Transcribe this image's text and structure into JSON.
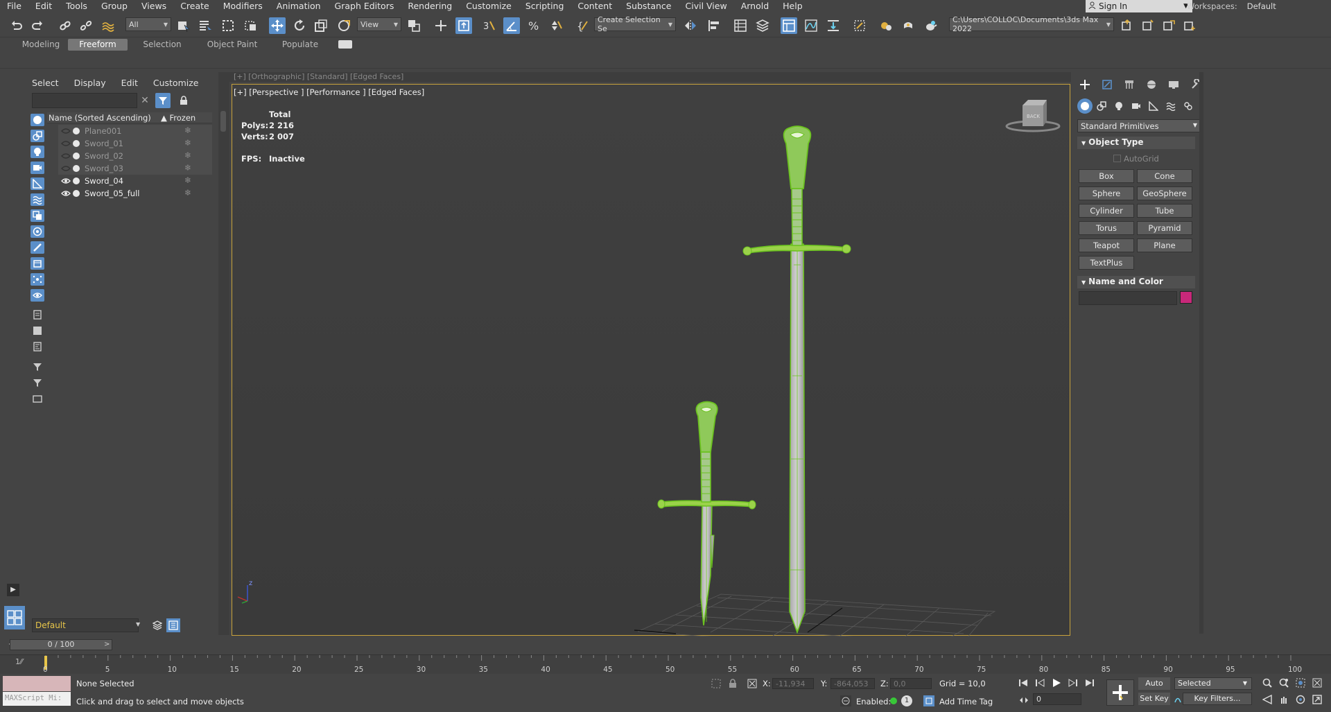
{
  "menu": [
    "File",
    "Edit",
    "Tools",
    "Group",
    "Views",
    "Create",
    "Modifiers",
    "Animation",
    "Graph Editors",
    "Rendering",
    "Customize",
    "Scripting",
    "Content",
    "Substance",
    "Civil View",
    "Arnold",
    "Help"
  ],
  "account": {
    "signin": "Sign In",
    "workspace_label": "Workspaces:",
    "workspace_value": "Default"
  },
  "toolbar": {
    "filter": "All",
    "refcoord": "View",
    "selset": "Create Selection Se",
    "project_path": "C:\\Users\\COLLOC\\Documents\\3ds Max 2022"
  },
  "ribbon_tabs": [
    "Modeling",
    "Freeform",
    "Selection",
    "Object Paint",
    "Populate"
  ],
  "explorer": {
    "menu": [
      "Select",
      "Display",
      "Edit",
      "Customize"
    ],
    "col_name": "Name (Sorted Ascending)",
    "col_frozen": "▲ Frozen",
    "rows": [
      {
        "name": "Plane001",
        "visible": false
      },
      {
        "name": "Sword_01",
        "visible": false
      },
      {
        "name": "Sword_02",
        "visible": false
      },
      {
        "name": "Sword_03",
        "visible": false
      },
      {
        "name": "Sword_04",
        "visible": true
      },
      {
        "name": "Sword_05_full",
        "visible": true
      }
    ],
    "layer": "Default"
  },
  "viewport": {
    "top_label": "[+] [Orthographic] [Standard] [Edged Faces]",
    "label": "[+] [Perspective ] [Performance ] [Edged Faces]",
    "stats": {
      "total": "Total",
      "polys_label": "Polys:",
      "polys": "2 216",
      "verts_label": "Verts:",
      "verts": "2 007",
      "fps_label": "FPS:",
      "fps": "Inactive"
    }
  },
  "command_panel": {
    "category": "Standard Primitives",
    "object_type": "Object Type",
    "autogrid": "AutoGrid",
    "buttons": [
      "Box",
      "Cone",
      "Sphere",
      "GeoSphere",
      "Cylinder",
      "Tube",
      "Torus",
      "Pyramid",
      "Teapot",
      "Plane",
      "TextPlus"
    ],
    "name_and_color": "Name and Color",
    "color": "#c8287a"
  },
  "time": {
    "slider": "0 / 100",
    "ticks": [
      "0",
      "5",
      "10",
      "15",
      "20",
      "25",
      "30",
      "35",
      "40",
      "45",
      "50",
      "55",
      "60",
      "65",
      "70",
      "75",
      "80",
      "85",
      "90",
      "95",
      "100"
    ]
  },
  "status": {
    "maxscript": "MAXScript Mi:",
    "selection": "None Selected",
    "prompt": "Click and drag to select and move objects",
    "x_label": "X:",
    "x": "-11,934",
    "y_label": "Y:",
    "y": "-864,053",
    "z_label": "Z:",
    "z": "0,0",
    "grid": "Grid = 10,0",
    "enabled": "Enabled:",
    "add_time_tag": "Add Time Tag",
    "auto_key": "Auto Key",
    "set_key": "Set Key",
    "selected": "Selected",
    "key_filters": "Key Filters...",
    "frame": "0"
  },
  "colors": {
    "accent": "#5b8fc9",
    "viewport_border": "#c9a33c",
    "wire": "#7fd42a",
    "layer_text": "#e8c64a"
  }
}
